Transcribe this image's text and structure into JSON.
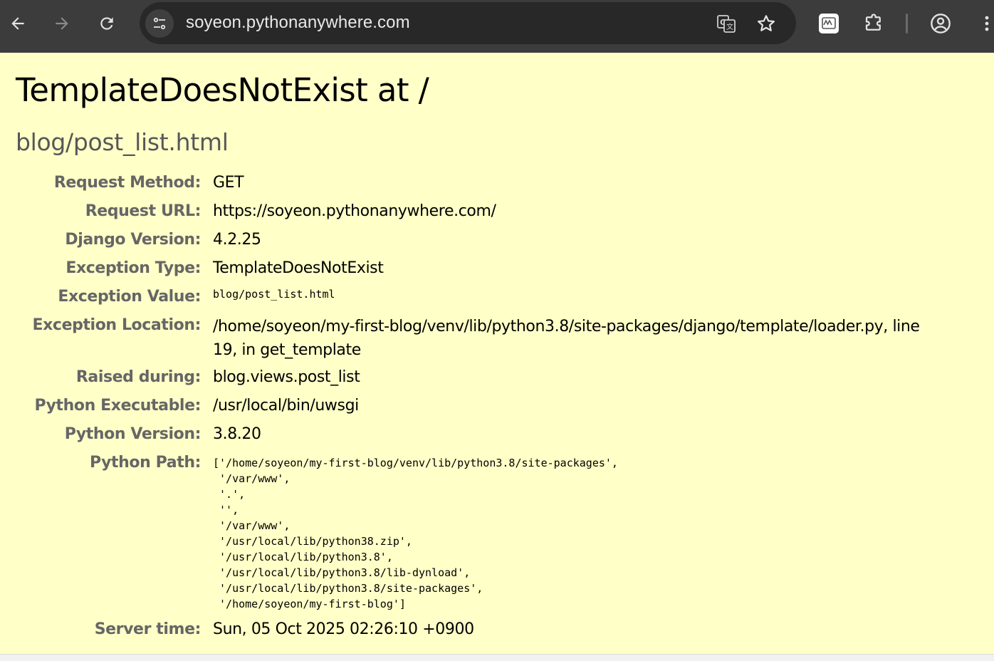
{
  "browser": {
    "url": "soyeon.pythonanywhere.com",
    "icons": {
      "back": "arrow-left-icon",
      "forward": "arrow-right-icon",
      "reload": "reload-icon",
      "site_info": "tune-icon",
      "translate": "translate-icon",
      "bookmark": "star-icon",
      "extension": "extension-app-icon",
      "extensions": "puzzle-icon",
      "profile": "account-circle-icon",
      "menu": "kebab-menu-icon"
    }
  },
  "page": {
    "title": "TemplateDoesNotExist at /",
    "subtitle": "blog/post_list.html",
    "rows": [
      {
        "label": "Request Method:",
        "value": "GET"
      },
      {
        "label": "Request URL:",
        "value": "https://soyeon.pythonanywhere.com/"
      },
      {
        "label": "Django Version:",
        "value": "4.2.25"
      },
      {
        "label": "Exception Type:",
        "value": "TemplateDoesNotExist"
      },
      {
        "label": "Exception Value:",
        "value": "blog/post_list.html"
      },
      {
        "label": "Exception Location:",
        "value": "/home/soyeon/my-first-blog/venv/lib/python3.8/site-packages/django/template/loader.py, line 19, in get_template"
      },
      {
        "label": "Raised during:",
        "value": "blog.views.post_list"
      },
      {
        "label": "Python Executable:",
        "value": "/usr/local/bin/uwsgi"
      },
      {
        "label": "Python Version:",
        "value": "3.8.20"
      },
      {
        "label": "Python Path:",
        "value": "['/home/soyeon/my-first-blog/venv/lib/python3.8/site-packages',\n '/var/www',\n '.',\n '',\n '/var/www',\n '/usr/local/lib/python38.zip',\n '/usr/local/lib/python3.8',\n '/usr/local/lib/python3.8/lib-dynload',\n '/usr/local/lib/python3.8/site-packages',\n '/home/soyeon/my-first-blog']"
      },
      {
        "label": "Server time:",
        "value": "Sun, 05 Oct 2025 02:26:10 +0900"
      }
    ]
  },
  "colors": {
    "page_background": "#ffffc8",
    "toolbar": "#3c3c3c",
    "omnibox": "#282828",
    "label_text": "#666666",
    "subtitle_text": "#575757"
  }
}
